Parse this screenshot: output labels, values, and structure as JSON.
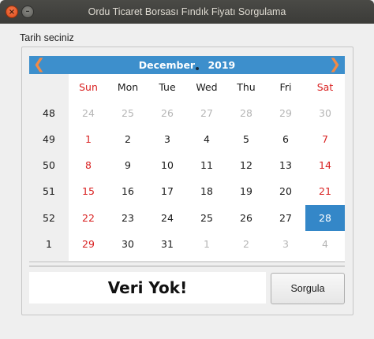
{
  "window": {
    "title": "Ordu Ticaret Borsası Fındık Fiyatı Sorgulama",
    "close_glyph": "×",
    "minimize_glyph": "–"
  },
  "prompt_label": "Tarih seciniz",
  "calendar": {
    "month": "December",
    "year": "2019",
    "prev_glyph": "❮",
    "next_glyph": "❯",
    "weekdays": [
      "Sun",
      "Mon",
      "Tue",
      "Wed",
      "Thu",
      "Fri",
      "Sat"
    ],
    "weeks": [
      {
        "week": "48",
        "days": [
          {
            "d": "24",
            "kind": "dim"
          },
          {
            "d": "25",
            "kind": "dim"
          },
          {
            "d": "26",
            "kind": "dim"
          },
          {
            "d": "27",
            "kind": "dim"
          },
          {
            "d": "28",
            "kind": "dim"
          },
          {
            "d": "29",
            "kind": "dim"
          },
          {
            "d": "30",
            "kind": "dim"
          }
        ]
      },
      {
        "week": "49",
        "days": [
          {
            "d": "1",
            "kind": "red"
          },
          {
            "d": "2",
            "kind": "normal"
          },
          {
            "d": "3",
            "kind": "normal"
          },
          {
            "d": "4",
            "kind": "normal"
          },
          {
            "d": "5",
            "kind": "normal"
          },
          {
            "d": "6",
            "kind": "normal"
          },
          {
            "d": "7",
            "kind": "red"
          }
        ]
      },
      {
        "week": "50",
        "days": [
          {
            "d": "8",
            "kind": "red"
          },
          {
            "d": "9",
            "kind": "normal"
          },
          {
            "d": "10",
            "kind": "normal"
          },
          {
            "d": "11",
            "kind": "normal"
          },
          {
            "d": "12",
            "kind": "normal"
          },
          {
            "d": "13",
            "kind": "normal"
          },
          {
            "d": "14",
            "kind": "red"
          }
        ]
      },
      {
        "week": "51",
        "days": [
          {
            "d": "15",
            "kind": "red"
          },
          {
            "d": "16",
            "kind": "normal"
          },
          {
            "d": "17",
            "kind": "normal"
          },
          {
            "d": "18",
            "kind": "normal"
          },
          {
            "d": "19",
            "kind": "normal"
          },
          {
            "d": "20",
            "kind": "normal"
          },
          {
            "d": "21",
            "kind": "red"
          }
        ]
      },
      {
        "week": "52",
        "days": [
          {
            "d": "22",
            "kind": "red"
          },
          {
            "d": "23",
            "kind": "normal"
          },
          {
            "d": "24",
            "kind": "normal"
          },
          {
            "d": "25",
            "kind": "normal"
          },
          {
            "d": "26",
            "kind": "normal"
          },
          {
            "d": "27",
            "kind": "normal"
          },
          {
            "d": "28",
            "kind": "selected"
          }
        ]
      },
      {
        "week": "1",
        "days": [
          {
            "d": "29",
            "kind": "red"
          },
          {
            "d": "30",
            "kind": "normal"
          },
          {
            "d": "31",
            "kind": "normal"
          },
          {
            "d": "1",
            "kind": "dim"
          },
          {
            "d": "2",
            "kind": "dim"
          },
          {
            "d": "3",
            "kind": "dim"
          },
          {
            "d": "4",
            "kind": "dim"
          }
        ]
      }
    ],
    "colors": {
      "header_bg": "#3d8fcc",
      "nav_arrow": "#f28a46",
      "weekend": "#d92020",
      "selected_bg": "#3487c8"
    }
  },
  "result_text": "Veri Yok!",
  "query_button_label": "Sorgula"
}
